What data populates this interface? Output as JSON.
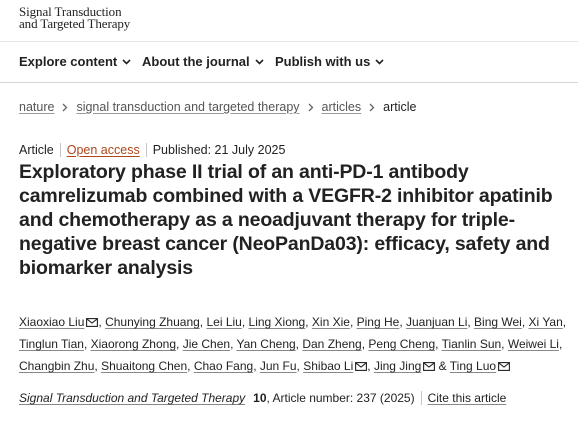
{
  "masthead": {
    "line1": "Signal Transduction",
    "line2": "and Targeted Therapy"
  },
  "nav": {
    "explore": "Explore content",
    "about": "About the journal",
    "publish": "Publish with us"
  },
  "breadcrumb": [
    "nature",
    "signal transduction and targeted therapy",
    "articles",
    "article"
  ],
  "meta": {
    "type": "Article",
    "access": "Open access",
    "published": "Published: 21 July 2025"
  },
  "title": "Exploratory phase II trial of an anti-PD-1 antibody camrelizumab combined with a VEGFR-2 inhibitor apatinib and chemotherapy as a neoadjuvant therapy for triple-negative breast cancer (NeoPanDa03): efficacy, safety and biomarker analysis",
  "authors": [
    {
      "name": "Xiaoxiao Liu",
      "mail": true
    },
    {
      "name": "Chunying Zhuang",
      "mail": false
    },
    {
      "name": "Lei Liu",
      "mail": false
    },
    {
      "name": "Ling Xiong",
      "mail": false
    },
    {
      "name": "Xin Xie",
      "mail": false
    },
    {
      "name": "Ping He",
      "mail": false
    },
    {
      "name": "Juanjuan Li",
      "mail": false
    },
    {
      "name": "Bing Wei",
      "mail": false
    },
    {
      "name": "Xi Yan",
      "mail": false
    },
    {
      "name": "Tinglun Tian",
      "mail": false
    },
    {
      "name": "Xiaorong Zhong",
      "mail": false
    },
    {
      "name": "Jie Chen",
      "mail": false
    },
    {
      "name": "Yan Cheng",
      "mail": false
    },
    {
      "name": "Dan Zheng",
      "mail": false
    },
    {
      "name": "Peng Cheng",
      "mail": false
    },
    {
      "name": "Tianlin Sun",
      "mail": false
    },
    {
      "name": "Weiwei Li",
      "mail": false
    },
    {
      "name": "Changbin Zhu",
      "mail": false
    },
    {
      "name": "Shuaitong Chen",
      "mail": false
    },
    {
      "name": "Chao Fang",
      "mail": false
    },
    {
      "name": "Jun Fu",
      "mail": false
    },
    {
      "name": "Shibao Li",
      "mail": true
    },
    {
      "name": "Jing Jing",
      "mail": true
    },
    {
      "name": "Ting Luo",
      "mail": true
    }
  ],
  "author_separator": ", ",
  "author_last_separator": " & ",
  "citation": {
    "journal": "Signal Transduction and Targeted Therapy",
    "volume": "10",
    "article_number": ", Article number: 237 (2025)",
    "cite_label": "Cite this article"
  },
  "icons": {
    "mail": "mail-icon",
    "chevron": "chevron-down-icon",
    "breadcrumb_separator": "chevron-right-icon"
  },
  "colors": {
    "open_access": "#b1461a",
    "text": "#222222"
  }
}
